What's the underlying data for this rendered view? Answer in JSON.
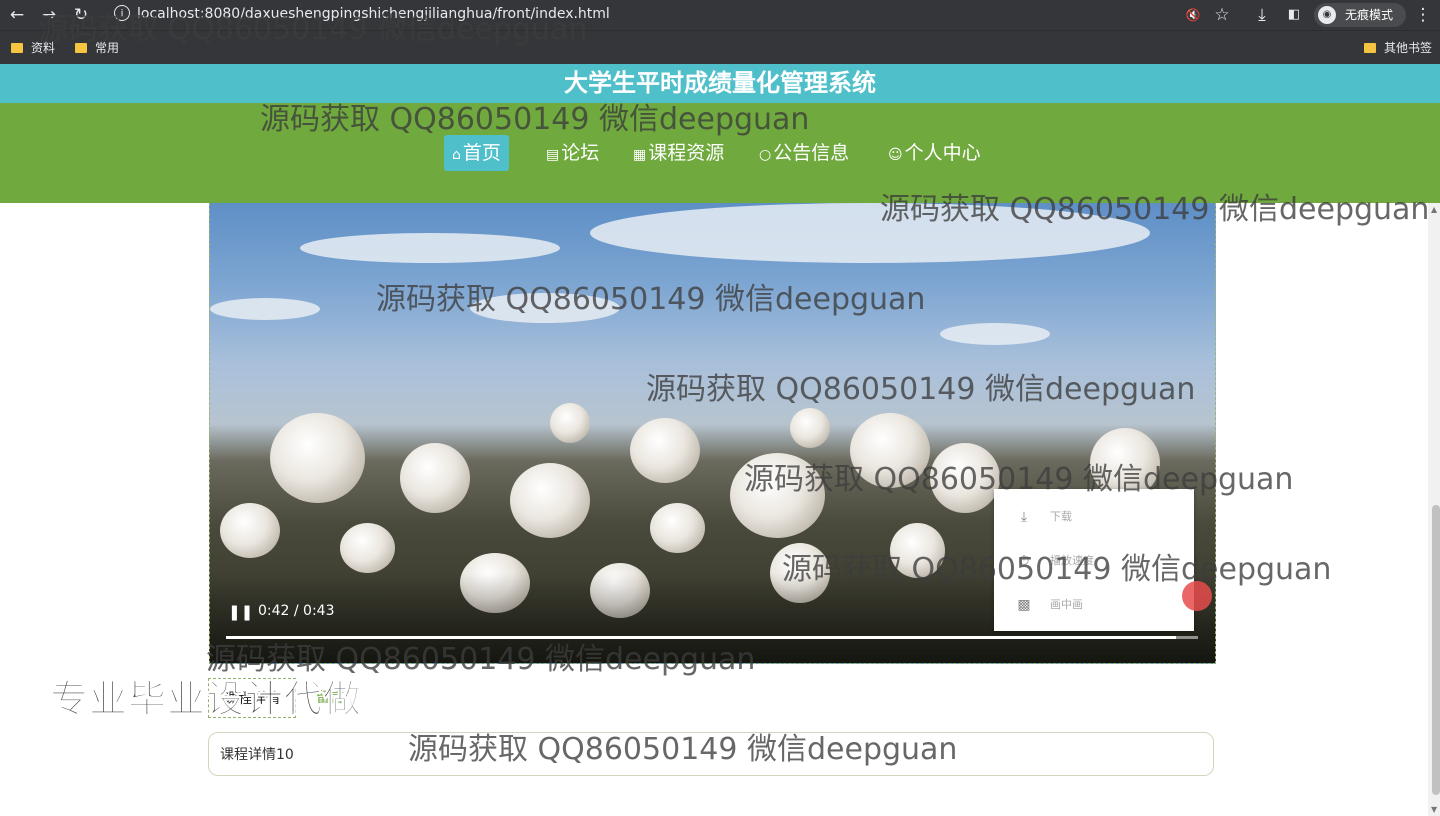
{
  "browser": {
    "url": "localhost:8080/daxueshengpingshichengjilianghua/front/index.html",
    "incognito_label": "无痕模式",
    "bookmarks": [
      "资料",
      "常用"
    ],
    "other_bookmarks": "其他书签"
  },
  "site": {
    "title": "大学生平时成绩量化管理系统",
    "nav": [
      {
        "icon": "home-icon",
        "label": "首页",
        "active": true
      },
      {
        "icon": "forum-icon",
        "label": "论坛",
        "active": false
      },
      {
        "icon": "course-icon",
        "label": "课程资源",
        "active": false
      },
      {
        "icon": "notice-icon",
        "label": "公告信息",
        "active": false
      },
      {
        "icon": "user-icon",
        "label": "个人中心",
        "active": false
      }
    ]
  },
  "video": {
    "time": "0:42 / 0:43",
    "progress": 0.977,
    "menu": [
      {
        "icon": "download-icon",
        "label": "下载"
      },
      {
        "icon": "speed-icon",
        "label": "播放速度"
      },
      {
        "icon": "pip-icon",
        "label": "画中画"
      }
    ]
  },
  "course": {
    "tab_detail": "课程详情",
    "tab_comment": "留言",
    "detail_text": "课程详情10"
  },
  "overlay": {
    "promo": "专业毕业设计代做",
    "watermark": "源码获取 QQ86050149 微信deepguan"
  }
}
